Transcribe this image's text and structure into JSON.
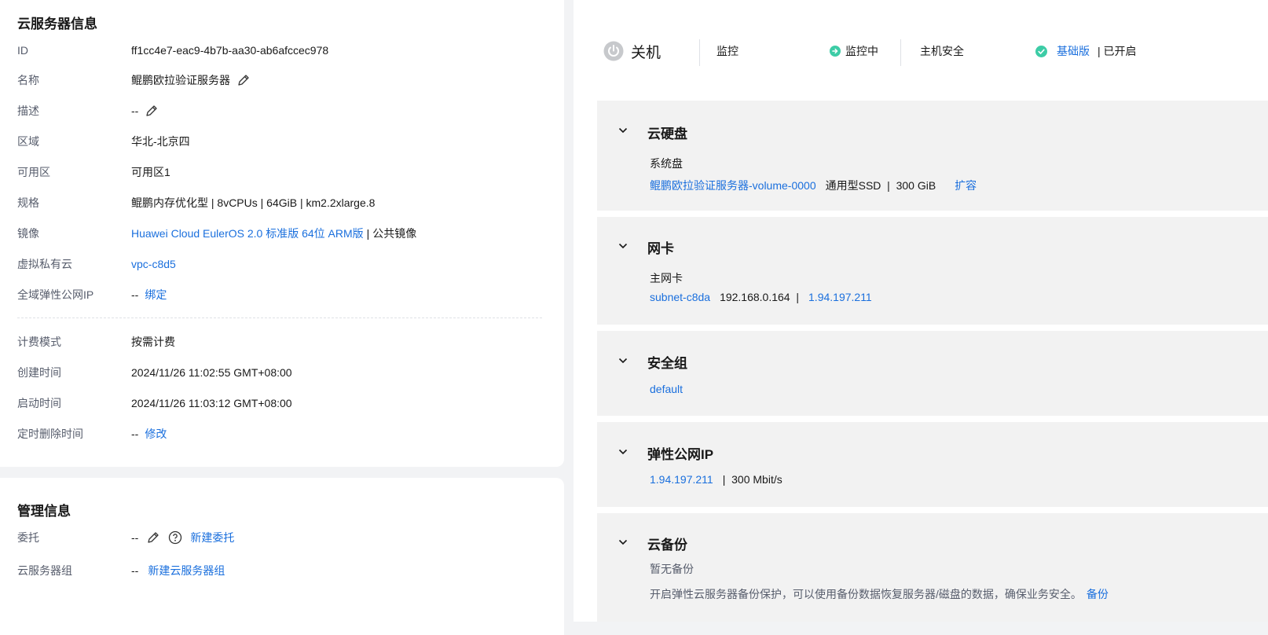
{
  "server_info": {
    "title": "云服务器信息",
    "id_label": "ID",
    "id_value": "ff1cc4e7-eac9-4b7b-aa30-ab6afccec978",
    "name_label": "名称",
    "name_value": "鲲鹏欧拉验证服务器",
    "desc_label": "描述",
    "desc_value": "--",
    "region_label": "区域",
    "region_value": "华北-北京四",
    "az_label": "可用区",
    "az_value": "可用区1",
    "flavor_label": "规格",
    "flavor_value": "鲲鹏内存优化型 | 8vCPUs | 64GiB | km2.2xlarge.8",
    "image_label": "镜像",
    "image_link": "Huawei Cloud EulerOS 2.0 标准版 64位 ARM版",
    "image_suffix": "| 公共镜像",
    "vpc_label": "虚拟私有云",
    "vpc_value": "vpc-c8d5",
    "eip_label": "全域弹性公网IP",
    "eip_value": "--",
    "eip_action": "绑定",
    "billing_label": "计费模式",
    "billing_value": "按需计费",
    "created_label": "创建时间",
    "created_value": "2024/11/26 11:02:55 GMT+08:00",
    "started_label": "启动时间",
    "started_value": "2024/11/26 11:03:12 GMT+08:00",
    "delete_label": "定时删除时间",
    "delete_value": "--",
    "delete_action": "修改"
  },
  "mgmt_info": {
    "title": "管理信息",
    "agency_label": "委托",
    "agency_value": "--",
    "agency_action": "新建委托",
    "group_label": "云服务器组",
    "group_value": "--",
    "group_action": "新建云服务器组"
  },
  "status_bar": {
    "power_label": "关机",
    "monitor_label": "监控",
    "monitor_status": "监控中",
    "security_label": "主机安全",
    "security_edition": "基础版",
    "security_status": "| 已开启"
  },
  "panels": {
    "disk": {
      "title": "云硬盘",
      "sub": "系统盘",
      "volume": "鲲鹏欧拉验证服务器-volume-0000",
      "spec": "通用型SSD  |  300 GiB",
      "action": "扩容"
    },
    "nic": {
      "title": "网卡",
      "sub": "主网卡",
      "subnet": "subnet-c8da",
      "ip": "192.168.0.164  |",
      "eip": "1.94.197.211"
    },
    "sg": {
      "title": "安全组",
      "name": "default"
    },
    "eip": {
      "title": "弹性公网IP",
      "ip": "1.94.197.211",
      "bandwidth": "|  300 Mbit/s"
    },
    "backup": {
      "title": "云备份",
      "empty": "暂无备份",
      "desc": "开启弹性云服务器备份保护，可以使用备份数据恢复服务器/磁盘的数据，确保业务安全。",
      "action": "备份"
    }
  },
  "colors": {
    "link": "#1a6fdd",
    "ok_green": "#3dcca6",
    "panel_bg": "#f2f2f2",
    "page_bg": "#f2f3f5"
  }
}
